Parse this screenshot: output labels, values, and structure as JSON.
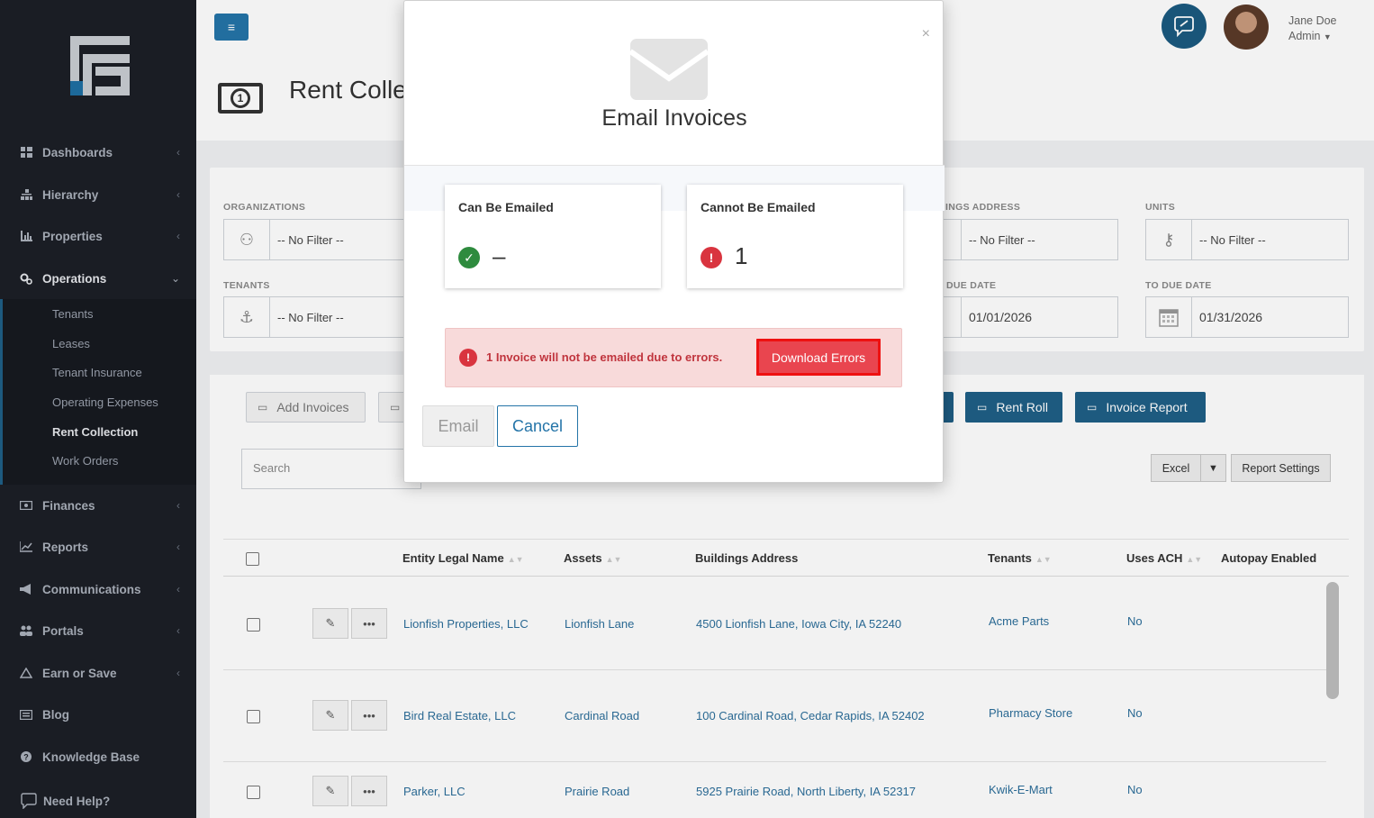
{
  "sidebar": {
    "nav": [
      {
        "label": "Dashboards",
        "icon": "dashboard-icon"
      },
      {
        "label": "Hierarchy",
        "icon": "hierarchy-icon"
      },
      {
        "label": "Properties",
        "icon": "chart-icon"
      },
      {
        "label": "Operations",
        "icon": "gears-icon"
      },
      {
        "label": "Finances",
        "icon": "money-icon"
      },
      {
        "label": "Reports",
        "icon": "line-chart-icon"
      },
      {
        "label": "Communications",
        "icon": "megaphone-icon"
      },
      {
        "label": "Portals",
        "icon": "users-icon"
      },
      {
        "label": "Earn or Save",
        "icon": "piggy-icon"
      },
      {
        "label": "Blog",
        "icon": "newspaper-icon"
      },
      {
        "label": "Knowledge Base",
        "icon": "question-icon"
      },
      {
        "label": "Need Help?",
        "icon": "chat-icon"
      }
    ],
    "operations_sub": [
      "Tenants",
      "Leases",
      "Tenant Insurance",
      "Operating Expenses",
      "Rent Collection",
      "Work Orders"
    ]
  },
  "header": {
    "user_name": "Jane Doe",
    "user_role": "Admin"
  },
  "page": {
    "title": "Rent Colle"
  },
  "filters": {
    "organizations_label": "ORGANIZATIONS",
    "organizations_value": "-- No Filter --",
    "tenants_label": "TENANTS",
    "tenants_value": "-- No Filter --",
    "buildings_label": "INGS ADDRESS",
    "buildings_value": "-- No Filter --",
    "units_label": "UNITS",
    "units_value": "-- No Filter --",
    "from_due_label": "DUE DATE",
    "from_due_value": "01/01/2026",
    "to_due_label": "TO DUE DATE",
    "to_due_value": "01/31/2026"
  },
  "toolbar": {
    "add_invoices": "Add Invoices",
    "rent_roll": "Rent Roll",
    "invoice_report": "Invoice Report",
    "search_placeholder": "Search",
    "excel": "Excel",
    "dropdown": "▼",
    "report_settings": "Report Settings"
  },
  "table": {
    "columns": [
      "Entity Legal Name",
      "Assets",
      "Buildings Address",
      "Tenants",
      "Uses ACH",
      "Autopay Enabled"
    ],
    "rows": [
      {
        "entity": "Lionfish Properties, LLC",
        "asset": "Lionfish Lane",
        "address": "4500 Lionfish Lane, Iowa City, IA 52240",
        "tenant": "Acme Parts",
        "ach": "No"
      },
      {
        "entity": "Bird Real Estate, LLC",
        "asset": "Cardinal Road",
        "address": "100 Cardinal Road, Cedar Rapids, IA 52402",
        "tenant": "Pharmacy Store",
        "ach": "No"
      },
      {
        "entity": "Parker, LLC",
        "asset": "Prairie Road",
        "address": "5925 Prairie Road, North Liberty, IA 52317",
        "tenant": "Kwik-E-Mart",
        "ach": "No"
      }
    ]
  },
  "modal": {
    "title": "Email Invoices",
    "close": "×",
    "can_label": "Can Be Emailed",
    "can_value": "–",
    "cannot_label": "Cannot Be Emailed",
    "cannot_value": "1",
    "alert_text": "1 Invoice will not be emailed due to errors.",
    "download_errors": "Download Errors",
    "email": "Email",
    "cancel": "Cancel"
  },
  "colors": {
    "sidebar_bg": "#1c1f26",
    "primary": "#1f5f86",
    "danger": "#e9454f",
    "success": "#2e8b3e"
  }
}
